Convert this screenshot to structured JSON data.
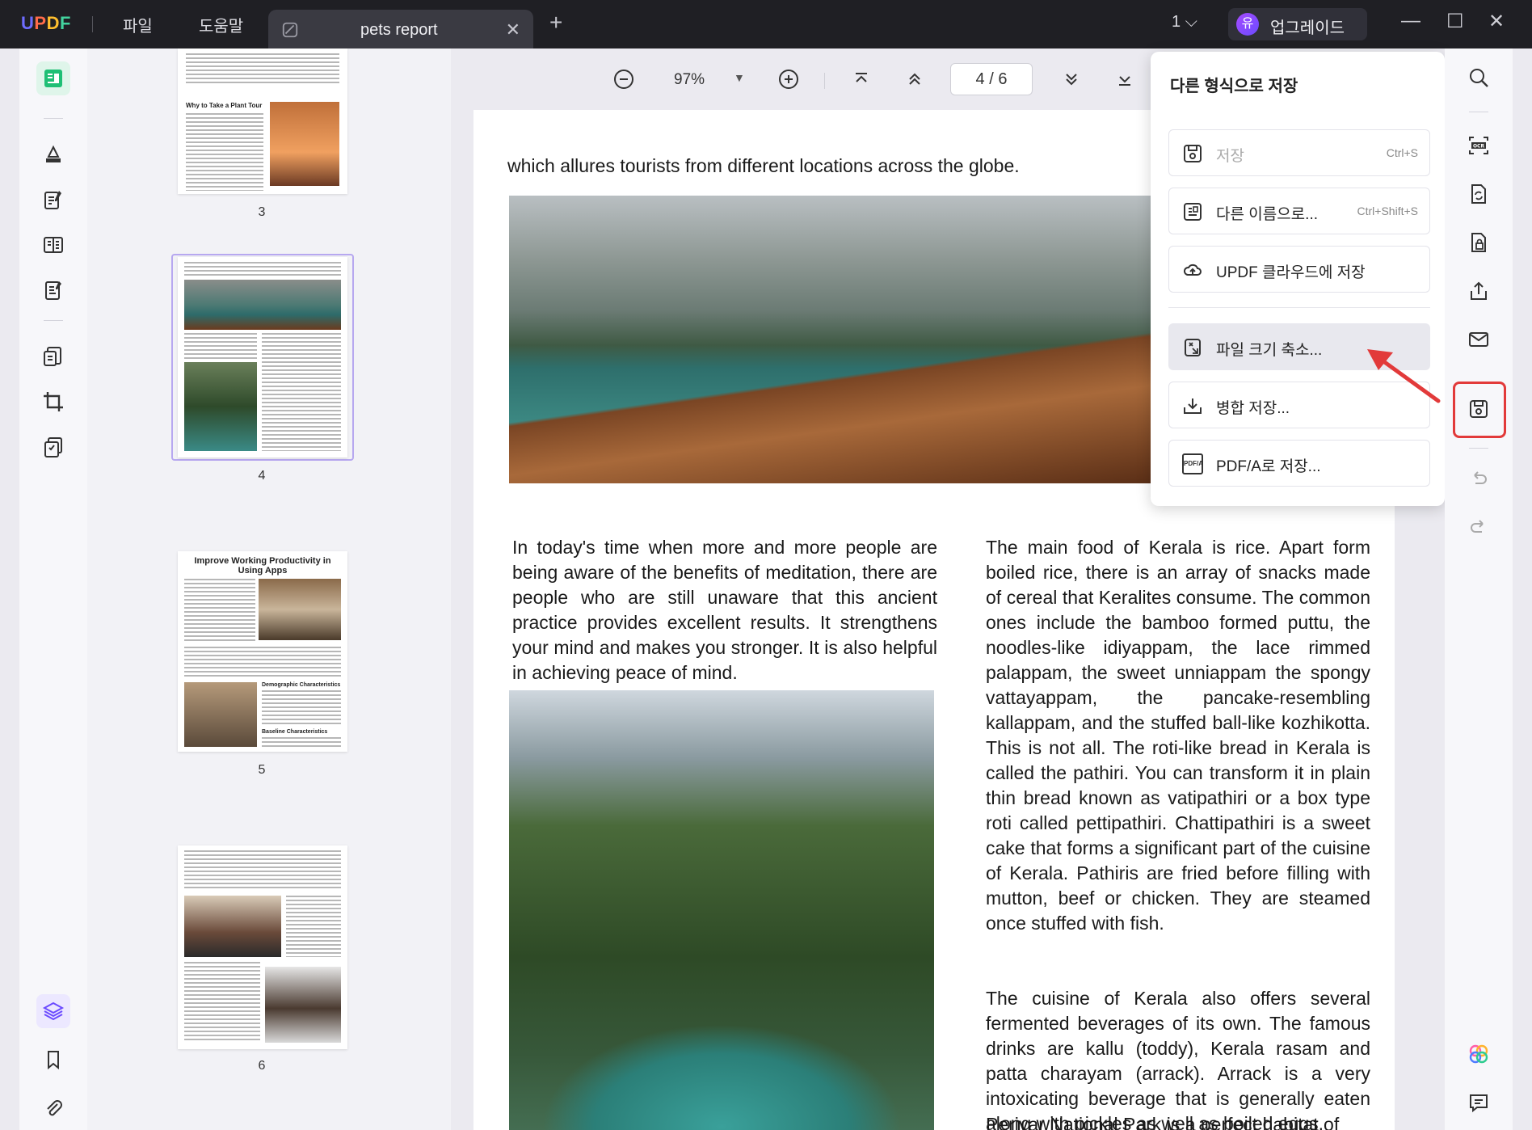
{
  "app": {
    "logo": "UPDF",
    "menu": [
      "파일",
      "도움말"
    ],
    "tab_title": "pets report",
    "page_selector": "1",
    "upgrade_avatar": "유",
    "upgrade_label": "업그레이드"
  },
  "viewer": {
    "zoom": "97%",
    "page_indicator": "4 / 6"
  },
  "thumbnails": [
    {
      "label": "3",
      "heading": "Why to Take a Plant Tour"
    },
    {
      "label": "4"
    },
    {
      "label": "5",
      "title": "Improve Working Productivity in Using Apps",
      "subheads": [
        "Demographic Characteristics",
        "Baseline Characteristics"
      ]
    },
    {
      "label": "6"
    }
  ],
  "document": {
    "top_line": "which allures tourists from different locations across the globe.",
    "para_left": "In today's time when more and more people are being aware of the benefits of meditation, there are people who are still unaware that this ancient practice provides excellent results. It strengthens your mind and makes you stronger. It is also helpful in achieving peace of mind.",
    "para_right_1": "The main food of Kerala is rice. Apart form boiled rice, there is an array of snacks made of cereal that Keralites consume. The common ones include the bamboo formed puttu, the noodles-like idiyappam, the lace rimmed palappam, the sweet unniappam the spongy vattayappam, the pancake-resembling kallappam, and the stuffed ball-like kozhikotta. This is not all. The roti-like bread in Kerala is called the pathiri. You can transform it in plain thin bread known as vatipathiri or a box type roti called pettipathiri. Chattipathiri is a sweet cake that forms a significant part of the cuisine of Kerala. Pathiris are fried before filling with mutton, beef or chicken. They are steamed once stuffed with fish.",
    "para_right_2": "The cuisine of Kerala also offers several fermented beverages of its own. The famous drinks are kallu (toddy), Kerala rasam and patta charayam (arrack). Arrack is a very intoxicating beverage that is generally eaten along with pickles as well as boiled eggs.",
    "para_right_3": "Periyar National Park is a perfect habitat of"
  },
  "save_panel": {
    "title": "다른 형식으로 저장",
    "options": [
      {
        "label": "저장",
        "shortcut": "Ctrl+S",
        "icon": "save-icon"
      },
      {
        "label": "다른 이름으로...",
        "shortcut": "Ctrl+Shift+S",
        "icon": "save-as-icon"
      },
      {
        "label": "UPDF 클라우드에 저장",
        "icon": "cloud-icon"
      },
      {
        "label": "파일 크기 축소...",
        "icon": "compress-icon"
      },
      {
        "label": "병합 저장...",
        "icon": "flatten-icon"
      },
      {
        "label": "PDF/A로 저장...",
        "icon": "pdfa-icon"
      }
    ],
    "pdfa_icon_text": "PDF/A",
    "ocr_icon_text": "OCR"
  },
  "colors": {
    "accent_green": "#1fbf75",
    "highlight_red": "#e23a3a",
    "titlebar": "#1f1f24"
  }
}
